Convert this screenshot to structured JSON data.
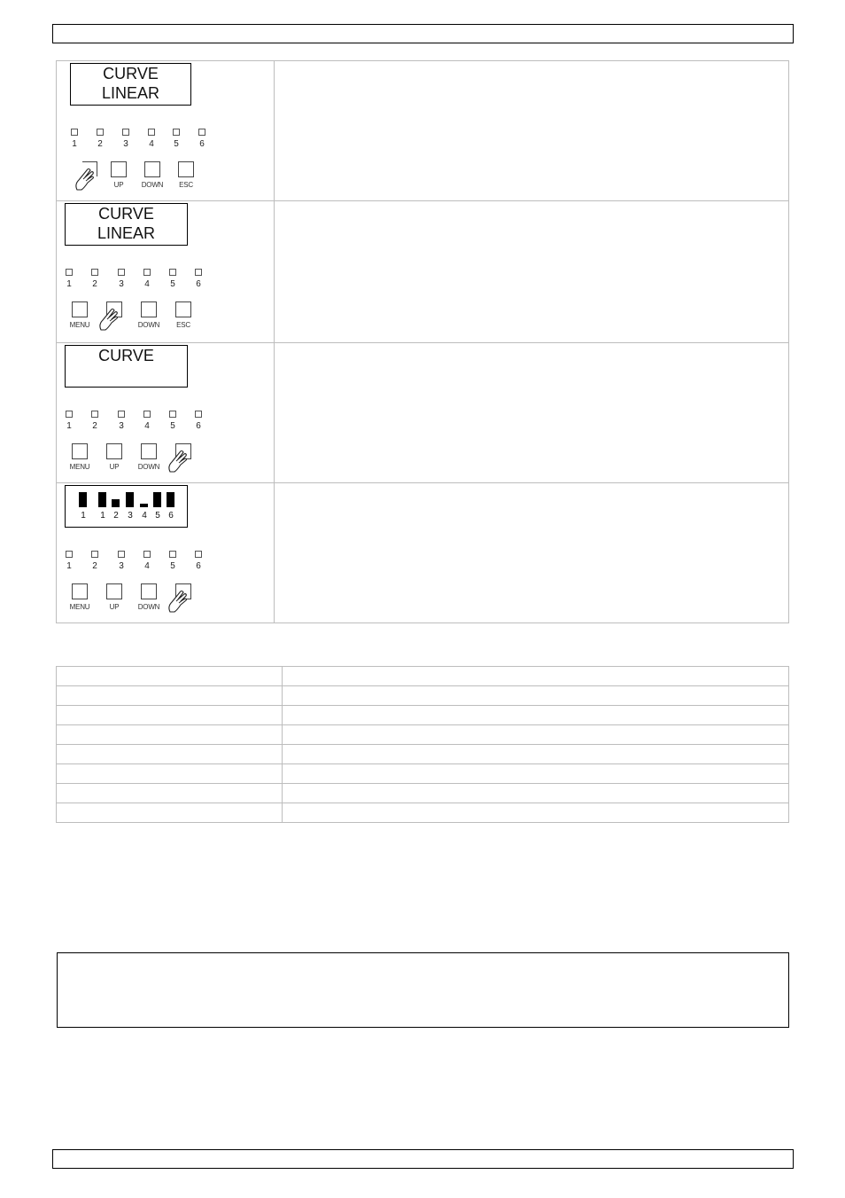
{
  "page": {
    "header_text": "",
    "footer_text": "",
    "note_text": ""
  },
  "steps": [
    {
      "lcd_lines": [
        "CURVE",
        "LINEAR"
      ],
      "leds": [
        "1",
        "2",
        "3",
        "4",
        "5",
        "6"
      ],
      "buttons": [
        "",
        "UP",
        "DOWN",
        "ESC"
      ],
      "pressed_button": 0,
      "description": ""
    },
    {
      "lcd_lines": [
        "CURVE",
        "LINEAR"
      ],
      "leds": [
        "1",
        "2",
        "3",
        "4",
        "5",
        "6"
      ],
      "buttons": [
        "MENU",
        "",
        "DOWN",
        "ESC"
      ],
      "pressed_button": 1,
      "description": ""
    },
    {
      "lcd_lines": [
        "CURVE",
        ""
      ],
      "leds": [
        "1",
        "2",
        "3",
        "4",
        "5",
        "6"
      ],
      "buttons": [
        "MENU",
        "UP",
        "DOWN",
        ""
      ],
      "pressed_button": 3,
      "description": ""
    },
    {
      "lcd_bars": {
        "labels": [
          "1",
          "1",
          "2",
          "3",
          "4",
          "5",
          "6"
        ],
        "levels": [
          1.0,
          1.0,
          0.55,
          1.0,
          0.25,
          1.0,
          1.0
        ]
      },
      "leds": [
        "1",
        "2",
        "3",
        "4",
        "5",
        "6"
      ],
      "buttons": [
        "MENU",
        "UP",
        "DOWN",
        ""
      ],
      "pressed_button": 3,
      "description": ""
    }
  ],
  "grid_rows": [
    [
      "",
      ""
    ],
    [
      "",
      ""
    ],
    [
      "",
      ""
    ],
    [
      "",
      ""
    ],
    [
      "",
      ""
    ],
    [
      "",
      ""
    ],
    [
      "",
      ""
    ],
    [
      "",
      ""
    ]
  ],
  "icons": {
    "hand": "pointing-hand-icon",
    "led": "led-indicator-icon"
  }
}
